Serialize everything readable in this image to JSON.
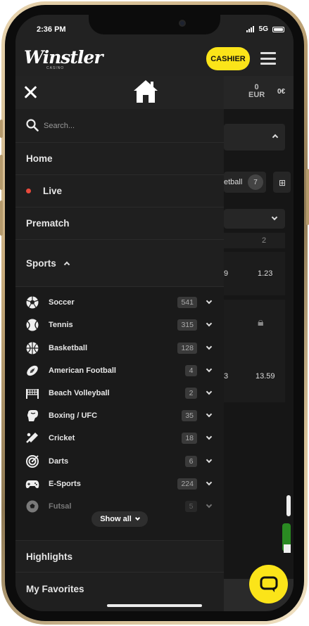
{
  "status": {
    "time": "2:36 PM",
    "network": "5G"
  },
  "header": {
    "logo": "Winstler",
    "logo_sub": "CASINO",
    "cashier_label": "CASHIER"
  },
  "balance": {
    "amount": "0",
    "currency": "EUR",
    "bonus": "0€"
  },
  "background": {
    "tab_label": "etball",
    "tab_count": "7",
    "col_label": "2",
    "odds": [
      "9",
      "1.23",
      "3",
      "13.59"
    ]
  },
  "search": {
    "placeholder": "Search..."
  },
  "nav": {
    "home": "Home",
    "live": "Live",
    "prematch": "Prematch",
    "sports": "Sports",
    "highlights": "Highlights",
    "favorites": "My Favorites"
  },
  "sports": [
    {
      "name": "Soccer",
      "count": "541",
      "icon": "soccer-ball-icon"
    },
    {
      "name": "Tennis",
      "count": "315",
      "icon": "tennis-ball-icon"
    },
    {
      "name": "Basketball",
      "count": "128",
      "icon": "basketball-icon"
    },
    {
      "name": "American Football",
      "count": "4",
      "icon": "american-football-icon"
    },
    {
      "name": "Beach Volleyball",
      "count": "2",
      "icon": "volleyball-net-icon"
    },
    {
      "name": "Boxing / UFC",
      "count": "35",
      "icon": "boxing-glove-icon"
    },
    {
      "name": "Cricket",
      "count": "18",
      "icon": "cricket-bat-icon"
    },
    {
      "name": "Darts",
      "count": "6",
      "icon": "dartboard-icon"
    },
    {
      "name": "E-Sports",
      "count": "224",
      "icon": "gamepad-icon"
    },
    {
      "name": "Futsal",
      "count": "5",
      "icon": "futsal-ball-icon"
    }
  ],
  "show_all": "Show all",
  "colors": {
    "accent": "#fbe419",
    "live": "#e84a3c",
    "drawer": "#1f1f1f"
  }
}
